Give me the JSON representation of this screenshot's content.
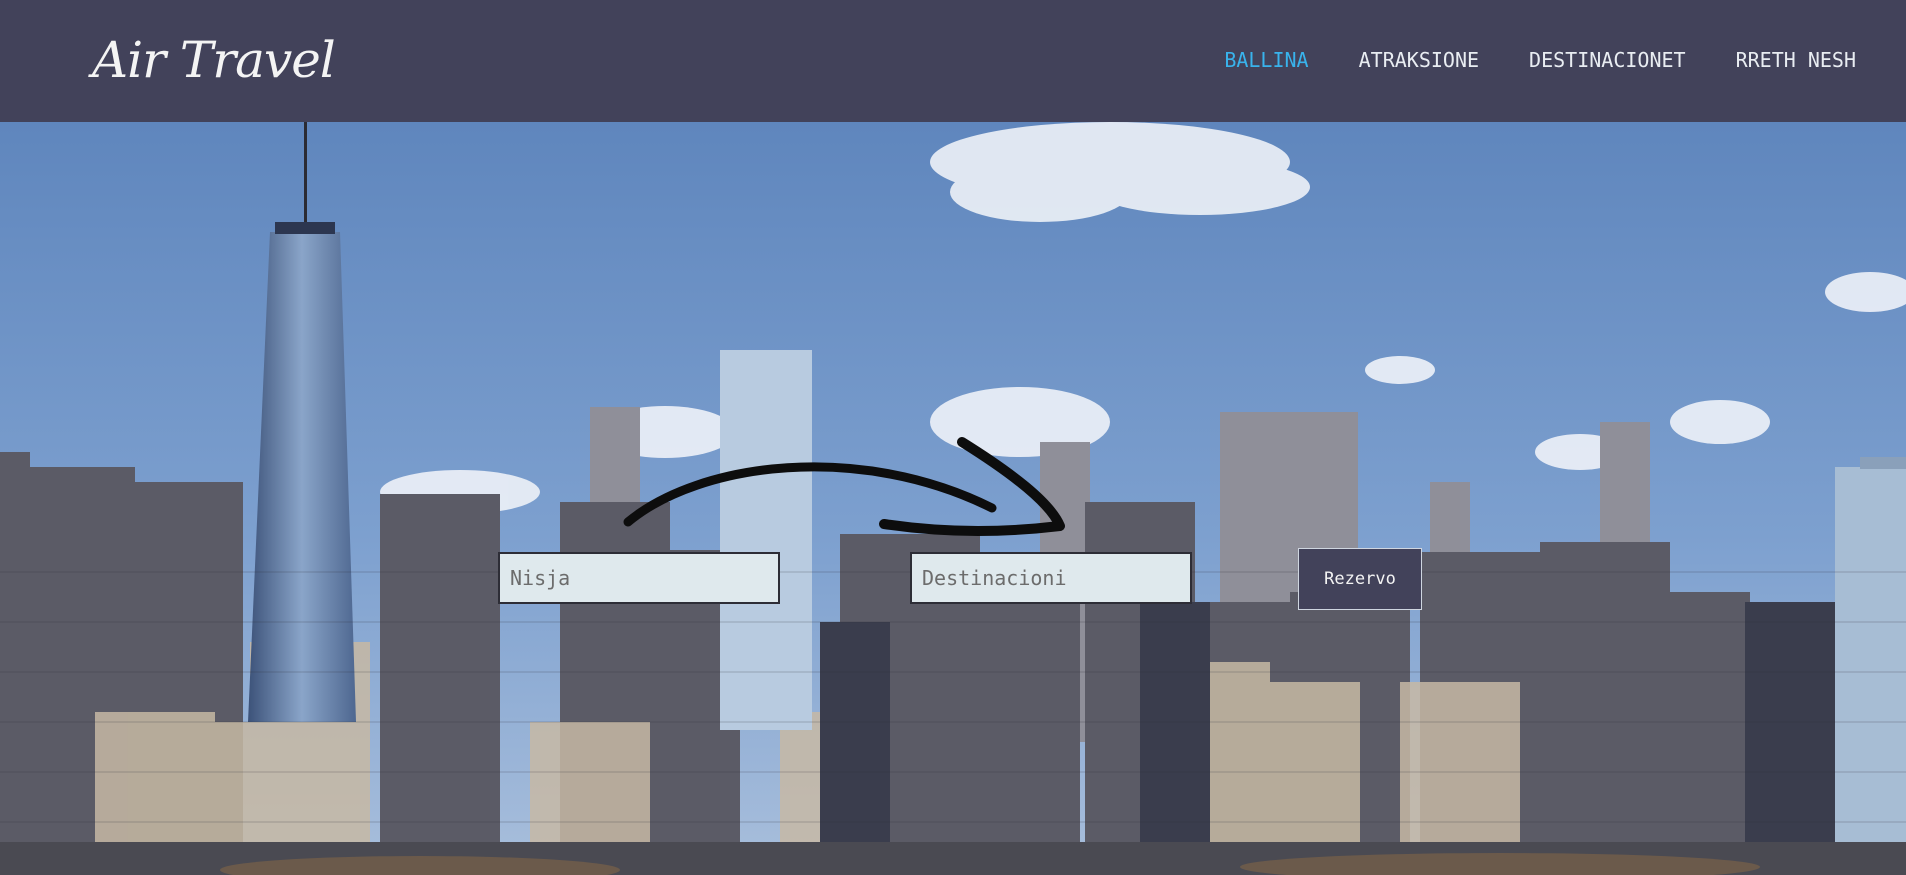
{
  "header": {
    "logo_text": "Air Travel",
    "nav": [
      {
        "label": "BALLINA",
        "active": true
      },
      {
        "label": "ATRAKSIONE",
        "active": false
      },
      {
        "label": "DESTINACIONET",
        "active": false
      },
      {
        "label": "RRETH NESH",
        "active": false
      }
    ]
  },
  "booking": {
    "origin_placeholder": "Nisja",
    "destination_placeholder": "Destinacioni",
    "submit_label": "Rezervo"
  },
  "colors": {
    "header_bg": "#42425a",
    "nav_active": "#39b3ec",
    "nav_text": "#e9edf2",
    "button_bg": "#42425a"
  }
}
